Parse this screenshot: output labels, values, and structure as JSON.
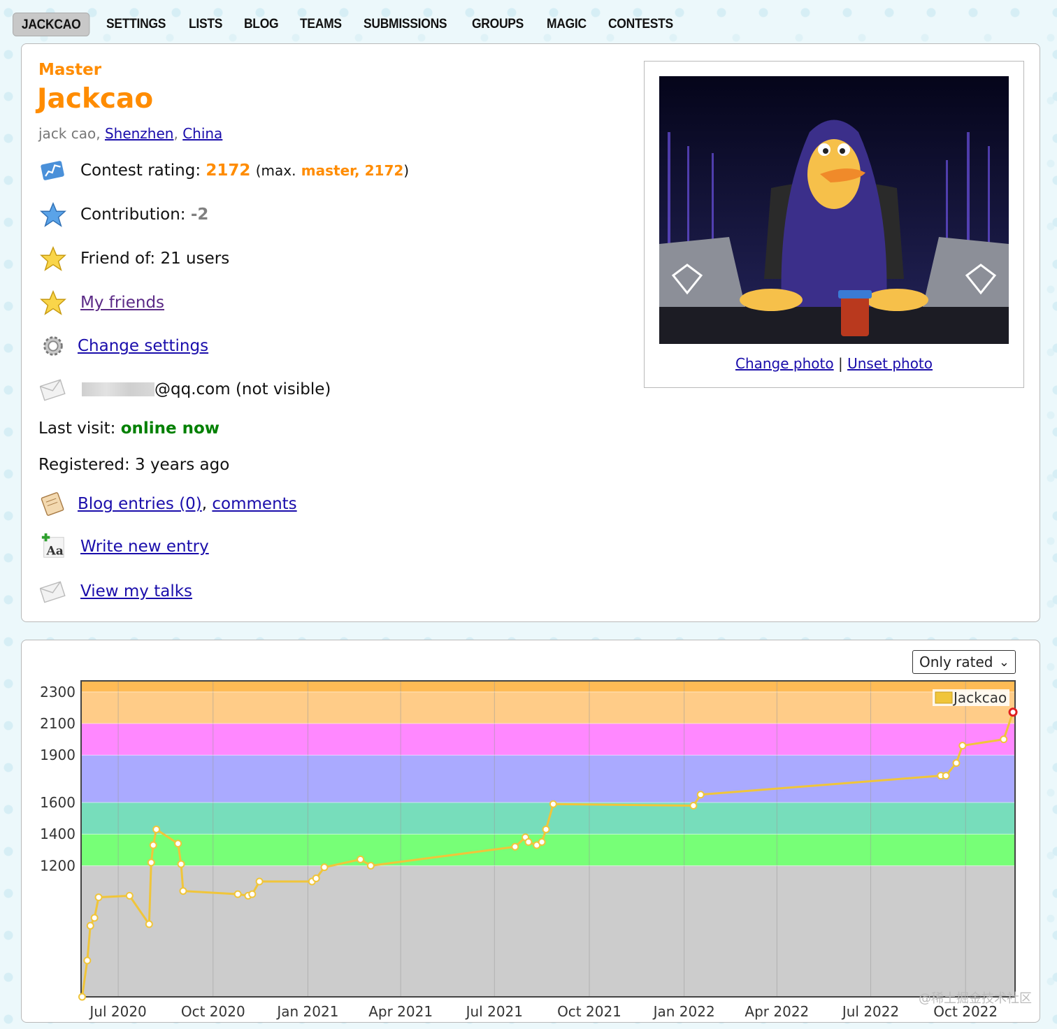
{
  "nav": {
    "items": [
      "JACKCAO",
      "SETTINGS",
      "LISTS",
      "BLOG",
      "TEAMS",
      "SUBMISSIONS",
      "GROUPS",
      "MAGIC",
      "CONTESTS"
    ]
  },
  "profile": {
    "rank": "Master",
    "handle": "Jackcao",
    "name_prefix": "jack cao,",
    "city": "Shenzhen",
    "country": "China",
    "rating_label": "Contest rating:",
    "rating_value": "2172",
    "max_open": "(max.",
    "max_value": "master, 2172",
    "max_close": ")",
    "contribution_label": "Contribution:",
    "contribution_value": "-2",
    "friend_of": "Friend of: 21 users",
    "my_friends": "My friends",
    "change_settings": "Change settings",
    "email_suffix": "@qq.com (not visible)",
    "last_visit_label": "Last visit:",
    "last_visit_value": "online now",
    "registered": "Registered: 3 years ago",
    "blog_entries": "Blog entries (0)",
    "comments": "comments",
    "write_new_entry": "Write new entry",
    "view_my_talks": "View my talks",
    "change_photo": "Change photo",
    "unset_photo": "Unset photo",
    "photo_sep": "|"
  },
  "chart_filter": {
    "selected": "Only rated"
  },
  "watermark": "@稀土掘金技术社区",
  "icons": [
    "chart-icon",
    "blue-star-icon",
    "star-icon",
    "star-icon",
    "gear-icon",
    "envelope-icon",
    "blog-icon",
    "write-entry-icon",
    "envelope-icon"
  ],
  "colors": {
    "accent": "#ff8c00",
    "online": "#008000",
    "link": "#1a0dab",
    "line": "#f0c53a"
  },
  "chart_data": {
    "type": "line",
    "title": "",
    "legend": [
      "Jackcao"
    ],
    "legend_position": "top-right",
    "yticks": [
      1200,
      1400,
      1600,
      1900,
      2100,
      2300
    ],
    "xticks": [
      "Jul 2020",
      "Oct 2020",
      "Jan 2021",
      "Apr 2021",
      "Jul 2021",
      "Oct 2021",
      "Jan 2022",
      "Apr 2022",
      "Jul 2022",
      "Oct 2022"
    ],
    "ylim": [
      370,
      2370
    ],
    "xlim": [
      "2020-05-26",
      "2022-11-18"
    ],
    "grid": true,
    "bands": [
      {
        "from": 370,
        "to": 1200,
        "color": "#cccccc"
      },
      {
        "from": 1200,
        "to": 1400,
        "color": "#77ff77"
      },
      {
        "from": 1400,
        "to": 1600,
        "color": "#77ddbb"
      },
      {
        "from": 1600,
        "to": 1900,
        "color": "#aaaaff"
      },
      {
        "from": 1900,
        "to": 2100,
        "color": "#ff88ff"
      },
      {
        "from": 2100,
        "to": 2300,
        "color": "#ffcc88"
      },
      {
        "from": 2300,
        "to": 2370,
        "color": "#ffbb55"
      }
    ],
    "series": [
      {
        "name": "Jackcao",
        "points": [
          [
            "2020-05-27",
            370
          ],
          [
            "2020-06-01",
            600
          ],
          [
            "2020-06-04",
            820
          ],
          [
            "2020-06-08",
            870
          ],
          [
            "2020-06-12",
            1000
          ],
          [
            "2020-07-12",
            1010
          ],
          [
            "2020-07-31",
            830
          ],
          [
            "2020-08-02",
            1220
          ],
          [
            "2020-08-04",
            1330
          ],
          [
            "2020-08-07",
            1430
          ],
          [
            "2020-08-28",
            1340
          ],
          [
            "2020-08-31",
            1210
          ],
          [
            "2020-09-02",
            1040
          ],
          [
            "2020-10-25",
            1020
          ],
          [
            "2020-11-04",
            1010
          ],
          [
            "2020-11-08",
            1020
          ],
          [
            "2020-11-15",
            1100
          ],
          [
            "2021-01-05",
            1100
          ],
          [
            "2021-01-09",
            1120
          ],
          [
            "2021-01-17",
            1190
          ],
          [
            "2021-02-21",
            1240
          ],
          [
            "2021-03-03",
            1200
          ],
          [
            "2021-07-21",
            1320
          ],
          [
            "2021-07-31",
            1380
          ],
          [
            "2021-08-03",
            1350
          ],
          [
            "2021-08-11",
            1330
          ],
          [
            "2021-08-16",
            1350
          ],
          [
            "2021-08-20",
            1430
          ],
          [
            "2021-08-27",
            1590
          ],
          [
            "2022-01-10",
            1580
          ],
          [
            "2022-01-17",
            1650
          ],
          [
            "2022-09-07",
            1770
          ],
          [
            "2022-09-12",
            1770
          ],
          [
            "2022-09-22",
            1850
          ],
          [
            "2022-09-28",
            1960
          ],
          [
            "2022-11-07",
            2000
          ],
          [
            "2022-11-16",
            2172
          ]
        ]
      }
    ]
  }
}
